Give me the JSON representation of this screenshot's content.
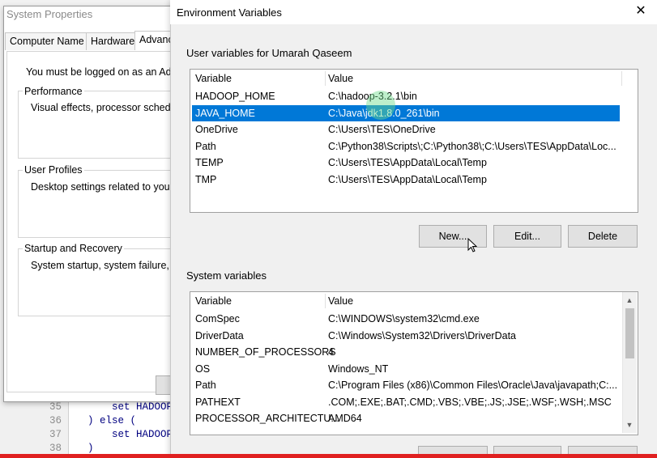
{
  "editor": {
    "lines": [
      {
        "num": "35",
        "code": "    set HADOOP"
      },
      {
        "num": "36",
        "code": ") else ("
      },
      {
        "num": "37",
        "code": "    set HADOOP"
      },
      {
        "num": "38",
        "code": ")"
      }
    ]
  },
  "system_properties": {
    "title": "System Properties",
    "tabs": [
      "Computer Name",
      "Hardware",
      "Advanc"
    ],
    "admin_notice": "You must be logged on as an Admi",
    "groups": [
      {
        "label": "Performance",
        "text": "Visual effects, processor schedulin"
      },
      {
        "label": "User Profiles",
        "text": "Desktop settings related to your si"
      },
      {
        "label": "Startup and Recovery",
        "text": "System startup, system failure, and"
      }
    ]
  },
  "env_dialog": {
    "title": "Environment Variables",
    "close_glyph": "✕",
    "user_section_label": "User variables for Umarah Qaseem",
    "user_columns": [
      "Variable",
      "Value"
    ],
    "user_vars": [
      {
        "name": "HADOOP_HOME",
        "value": "C:\\hadoop-3.2.1\\bin",
        "selected": false
      },
      {
        "name": "JAVA_HOME",
        "value": "C:\\Java\\jdk1.8.0_261\\bin",
        "selected": true
      },
      {
        "name": "OneDrive",
        "value": "C:\\Users\\TES\\OneDrive",
        "selected": false
      },
      {
        "name": "Path",
        "value": "C:\\Python38\\Scripts\\;C:\\Python38\\;C:\\Users\\TES\\AppData\\Loc...",
        "selected": false
      },
      {
        "name": "TEMP",
        "value": "C:\\Users\\TES\\AppData\\Local\\Temp",
        "selected": false
      },
      {
        "name": "TMP",
        "value": "C:\\Users\\TES\\AppData\\Local\\Temp",
        "selected": false
      }
    ],
    "user_buttons": {
      "new": "New...",
      "edit": "Edit...",
      "delete": "Delete"
    },
    "system_section_label": "System variables",
    "system_columns": [
      "Variable",
      "Value"
    ],
    "system_vars": [
      {
        "name": "ComSpec",
        "value": "C:\\WINDOWS\\system32\\cmd.exe"
      },
      {
        "name": "DriverData",
        "value": "C:\\Windows\\System32\\Drivers\\DriverData"
      },
      {
        "name": "NUMBER_OF_PROCESSORS",
        "value": "4"
      },
      {
        "name": "OS",
        "value": "Windows_NT"
      },
      {
        "name": "Path",
        "value": "C:\\Program Files (x86)\\Common Files\\Oracle\\Java\\javapath;C:..."
      },
      {
        "name": "PATHEXT",
        "value": ".COM;.EXE;.BAT;.CMD;.VBS;.VBE;.JS;.JSE;.WSF;.WSH;.MSC"
      },
      {
        "name": "PROCESSOR_ARCHITECTU...",
        "value": "AMD64"
      }
    ]
  },
  "colors": {
    "selection": "#0078d7",
    "video_progress": "#e02020"
  }
}
